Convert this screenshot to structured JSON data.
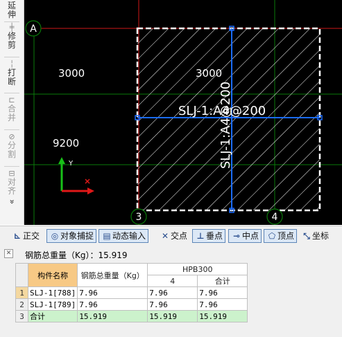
{
  "left_toolbar": {
    "items": [
      {
        "label": "延伸",
        "icon": "extend-icon",
        "enabled": true
      },
      {
        "label": "修剪",
        "icon": "trim-icon",
        "enabled": true
      },
      {
        "label": "打断",
        "icon": "break-icon",
        "enabled": true
      },
      {
        "label": "合并",
        "icon": "merge-icon",
        "enabled": false
      },
      {
        "label": "分割",
        "icon": "split-icon",
        "enabled": false
      },
      {
        "label": "对齐",
        "icon": "align-icon",
        "enabled": false
      }
    ],
    "more_glyph": "»"
  },
  "canvas": {
    "axis_labels": {
      "a": "A",
      "three": "3",
      "four": "4"
    },
    "dimensions": {
      "top_left": "3000",
      "top_right": "3000",
      "left_vertical": "9200"
    },
    "rebar_labels": {
      "horizontal": "SLJ-1:A4@200",
      "vertical": "SLJ-1:A4@200"
    },
    "ucs": {
      "y_label": "Y"
    },
    "colors": {
      "background": "#000000",
      "axis_red": "#d01818",
      "axis_green": "#0a7a0a",
      "hatch": "#ffffff",
      "rebar_blue": "#1a6cff"
    }
  },
  "snap_toolbar": {
    "items": [
      {
        "label": "正交",
        "icon": "ortho-icon",
        "active": false
      },
      {
        "label": "对象捕捉",
        "icon": "object-snap-icon",
        "active": true
      },
      {
        "label": "动态输入",
        "icon": "dynamic-input-icon",
        "active": true
      },
      {
        "label": "交点",
        "icon": "intersection-icon",
        "active": false
      },
      {
        "label": "垂点",
        "icon": "perpendicular-icon",
        "active": true
      },
      {
        "label": "中点",
        "icon": "midpoint-icon",
        "active": true
      },
      {
        "label": "顶点",
        "icon": "vertex-icon",
        "active": true
      },
      {
        "label": "坐标",
        "icon": "coordinate-icon",
        "active": false
      }
    ]
  },
  "info_panel": {
    "total_weight_text": "钢筋总重量（Kg）：15.919",
    "table": {
      "headers": {
        "name": "构件名称",
        "total": "钢筋总重量（Kg）",
        "group": "HPB300",
        "diameter": "4",
        "subtotal": "合计"
      },
      "rows": [
        {
          "no": "1",
          "name": "SLJ-1[788]",
          "total": "7.96",
          "d4": "7.96",
          "sum": "7.96"
        },
        {
          "no": "2",
          "name": "SLJ-1[789]",
          "total": "7.96",
          "d4": "7.96",
          "sum": "7.96"
        },
        {
          "no": "3",
          "name": "合计",
          "total": "15.919",
          "d4": "15.919",
          "sum": "15.919"
        }
      ]
    }
  }
}
